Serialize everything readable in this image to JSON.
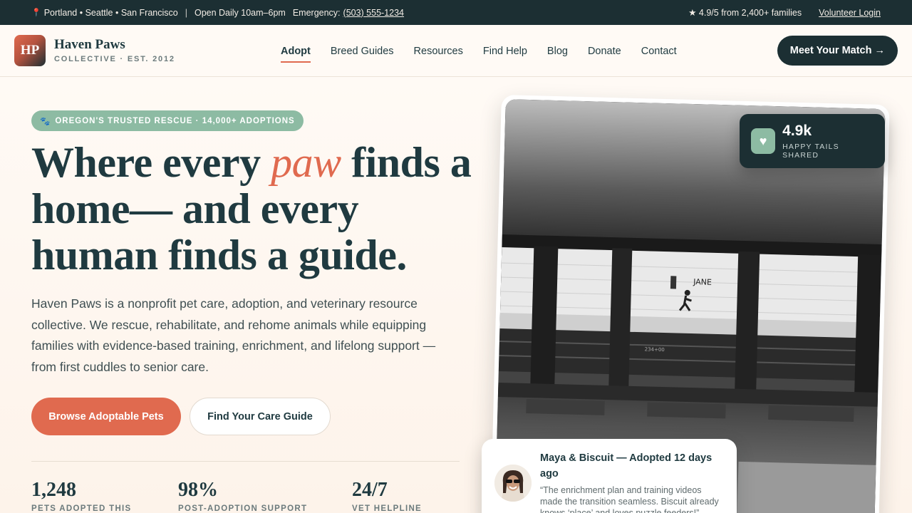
{
  "topbar": {
    "locations": "Portland • Seattle • San Francisco",
    "hours": "Open Daily 10am–6pm",
    "emergency_label": "Emergency:",
    "emergency_phone": "(503) 555-1234",
    "rating": "★ 4.9/5 from 2,400+ families",
    "volunteer_login": "Volunteer Login"
  },
  "brand": {
    "initials": "HP",
    "name": "Haven Paws",
    "tagline": "COLLECTIVE · EST. 2012"
  },
  "nav": {
    "items": [
      "Adopt",
      "Breed Guides",
      "Resources",
      "Find Help",
      "Blog",
      "Donate",
      "Contact"
    ],
    "active": "Adopt",
    "cta": "Meet Your Match →"
  },
  "hero": {
    "badge": "OREGON'S TRUSTED RESCUE · 14,000+ ADOPTIONS",
    "headline_pre": "Where every ",
    "headline_accent": "paw",
    "headline_post": " finds a home— and every human finds a guide.",
    "lead": "Haven Paws is a nonprofit pet care, adoption, and veterinary resource collective. We rescue, rehabilitate, and rehome animals while equipping families with evidence-based training, enrichment, and lifelong support — from first cuddles to senior care.",
    "primary_button": "Browse Adoptable Pets",
    "secondary_button": "Find Your Care Guide"
  },
  "stats": [
    {
      "value": "1,248",
      "label": "PETS ADOPTED THIS"
    },
    {
      "value": "98%",
      "label": "POST-ADOPTION SUPPORT"
    },
    {
      "value": "24/7",
      "label": "VET HELPLINE"
    }
  ],
  "photo": {
    "sign_text": "JANE",
    "plate_text": "234+00"
  },
  "stat_card": {
    "value": "4.9k",
    "label": "HAPPY TAILS SHARED"
  },
  "testimonial": {
    "name": "Maya & Biscuit — Adopted 12 days ago",
    "quote": "“The enrichment plan and training videos made the transition seamless. Biscuit already knows ‘place’ and loves puzzle feeders!”"
  }
}
